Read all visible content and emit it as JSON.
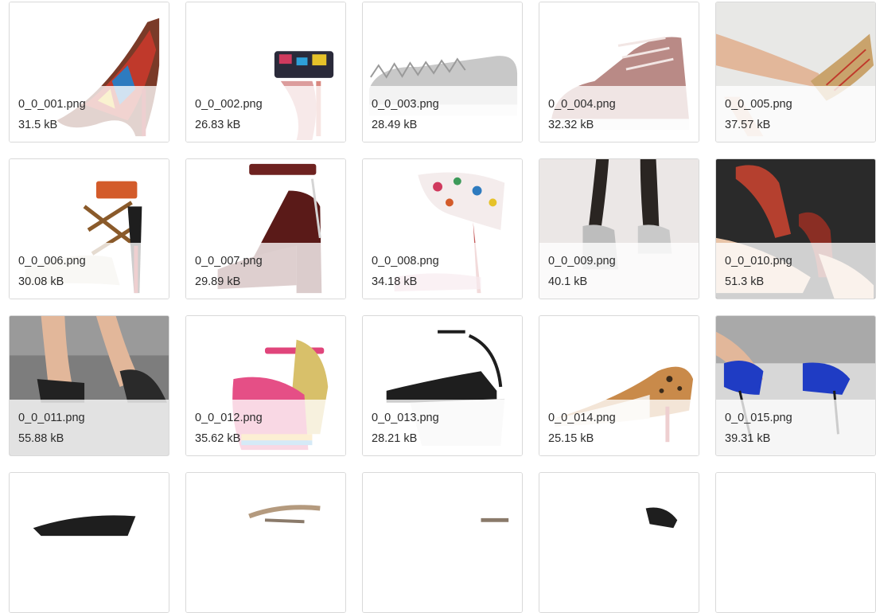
{
  "files": [
    {
      "name": "0_0_001.png",
      "size": "31.5 kB",
      "thumb": "heel-pump-multicolor",
      "bg": "#ffffff",
      "accent": "#c0392b"
    },
    {
      "name": "0_0_002.png",
      "size": "26.83 kB",
      "thumb": "strappy-sandal-multicolor",
      "bg": "#ffffff",
      "accent": "#d03a5e"
    },
    {
      "name": "0_0_003.png",
      "size": "28.49 kB",
      "thumb": "spiked-slip-on-sneaker",
      "bg": "#ffffff",
      "accent": "#c8c8c8"
    },
    {
      "name": "0_0_004.png",
      "size": "32.32 kB",
      "thumb": "high-top-sneaker-pink",
      "bg": "#ffffff",
      "accent": "#b98a86"
    },
    {
      "name": "0_0_005.png",
      "size": "37.57 kB",
      "thumb": "legs-in-pointed-heels",
      "bg": "#e8e8e6",
      "accent": "#c0392b"
    },
    {
      "name": "0_0_006.png",
      "size": "30.08 kB",
      "thumb": "cross-strap-heel-sandal",
      "bg": "#ffffff",
      "accent": "#d35b2a"
    },
    {
      "name": "0_0_007.png",
      "size": "29.89 kB",
      "thumb": "block-heel-sandal-burgundy",
      "bg": "#ffffff",
      "accent": "#6e2220"
    },
    {
      "name": "0_0_008.png",
      "size": "34.18 kB",
      "thumb": "floral-ankle-wrap-sandal",
      "bg": "#ffffff",
      "accent": "#3d9a5a"
    },
    {
      "name": "0_0_009.png",
      "size": "40.1 kB",
      "thumb": "crystal-platform-booties",
      "bg": "#ebe7e6",
      "accent": "#bdbdbd"
    },
    {
      "name": "0_0_010.png",
      "size": "51.3 kB",
      "thumb": "patterned-pumps-on-legs",
      "bg": "#2a2a2a",
      "accent": "#b5402f"
    },
    {
      "name": "0_0_011.png",
      "size": "55.88 kB",
      "thumb": "lace-heels-street",
      "bg": "#7d7d7d",
      "accent": "#222222"
    },
    {
      "name": "0_0_012.png",
      "size": "35.62 kB",
      "thumb": "pink-wedge-sandal",
      "bg": "#ffffff",
      "accent": "#e0457b"
    },
    {
      "name": "0_0_013.png",
      "size": "28.21 kB",
      "thumb": "clear-wedge-sandal-black",
      "bg": "#ffffff",
      "accent": "#1e1e1e"
    },
    {
      "name": "0_0_014.png",
      "size": "25.15 kB",
      "thumb": "leopard-kitten-heel-pump",
      "bg": "#ffffff",
      "accent": "#c98a4a"
    },
    {
      "name": "0_0_015.png",
      "size": "39.31 kB",
      "thumb": "blue-suede-sandals-legs",
      "bg": "#d7d7d7",
      "accent": "#1f3cc4"
    },
    {
      "name": "",
      "size": "",
      "thumb": "black-heel-partial",
      "bg": "#ffffff",
      "accent": "#1e1e1e"
    },
    {
      "name": "",
      "size": "",
      "thumb": "strappy-heel-partial",
      "bg": "#ffffff",
      "accent": "#b49a7e"
    },
    {
      "name": "",
      "size": "",
      "thumb": "sandal-partial",
      "bg": "#ffffff",
      "accent": "#8a7a6a"
    },
    {
      "name": "",
      "size": "",
      "thumb": "black-heel-partial",
      "bg": "#ffffff",
      "accent": "#1e1e1e"
    },
    {
      "name": "",
      "size": "",
      "thumb": "blank-partial",
      "bg": "#ffffff",
      "accent": "#e5e5e5"
    }
  ]
}
